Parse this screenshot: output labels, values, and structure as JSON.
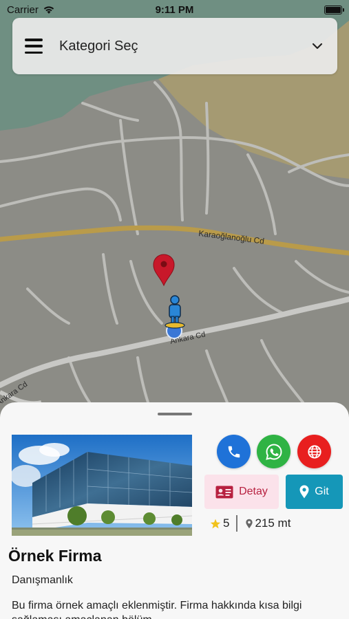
{
  "status_bar": {
    "carrier": "Carrier",
    "time": "9:11 PM",
    "battery_level": 1.0
  },
  "category_selector": {
    "label": "Kategori Seç",
    "menu_icon": "hamburger-icon",
    "dropdown_icon": "chevron-down-icon"
  },
  "map": {
    "road_labels": [
      "Karaoğlanoğlu Cd",
      "Ankara Cd",
      "Ankara Cd"
    ],
    "colors": {
      "land": "#8c8c86",
      "water": "#6f8f82",
      "sand": "#a59a72",
      "road": "#c8c8c5",
      "main_road": "#b99b4a"
    }
  },
  "company": {
    "name": "Örnek Firma",
    "category": "Danışmanlık",
    "description": "Bu firma örnek amaçlı eklenmiştir. Firma hakkında kısa bilgi sağlaması amaçlanan bölüm.",
    "rating": "5",
    "distance": "215 mt"
  },
  "actions": {
    "phone_icon": "phone-icon",
    "whatsapp_icon": "whatsapp-icon",
    "web_icon": "globe-icon",
    "detail_label": "Detay",
    "go_label": "Git",
    "colors": {
      "phone": "#1f72d8",
      "whatsapp": "#2fb344",
      "web": "#e81f1f",
      "detail_bg": "#fbe2ea",
      "detail_text": "#b7203f",
      "go": "#1597b8"
    }
  }
}
